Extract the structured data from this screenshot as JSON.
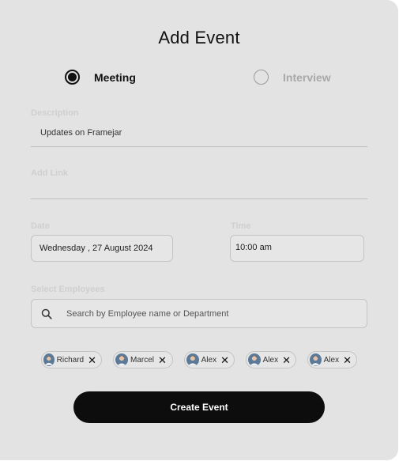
{
  "modal": {
    "title": "Add Event"
  },
  "event_type": {
    "options": [
      {
        "label": "Meeting",
        "selected": true
      },
      {
        "label": "Interview",
        "selected": false
      }
    ]
  },
  "description": {
    "label": "Description",
    "value": "Updates on Framejar"
  },
  "link": {
    "label": "Add Link",
    "value": ""
  },
  "date": {
    "label": "Date",
    "value": "Wednesday , 27 August 2024"
  },
  "time": {
    "label": "Time",
    "value": "10:00 am"
  },
  "employees": {
    "label": "Select Employees",
    "search_placeholder": "Search by Employee name or Department",
    "selected": [
      {
        "name": "Richard"
      },
      {
        "name": "Marcel"
      },
      {
        "name": "Alex"
      },
      {
        "name": "Alex"
      },
      {
        "name": "Alex"
      }
    ],
    "remove_glyph": "✕"
  },
  "actions": {
    "create_label": "Create Event"
  },
  "colors": {
    "background": "#e3e3e3",
    "primary_button": "#0d0d0d",
    "muted_text": "#a8a8a8"
  }
}
